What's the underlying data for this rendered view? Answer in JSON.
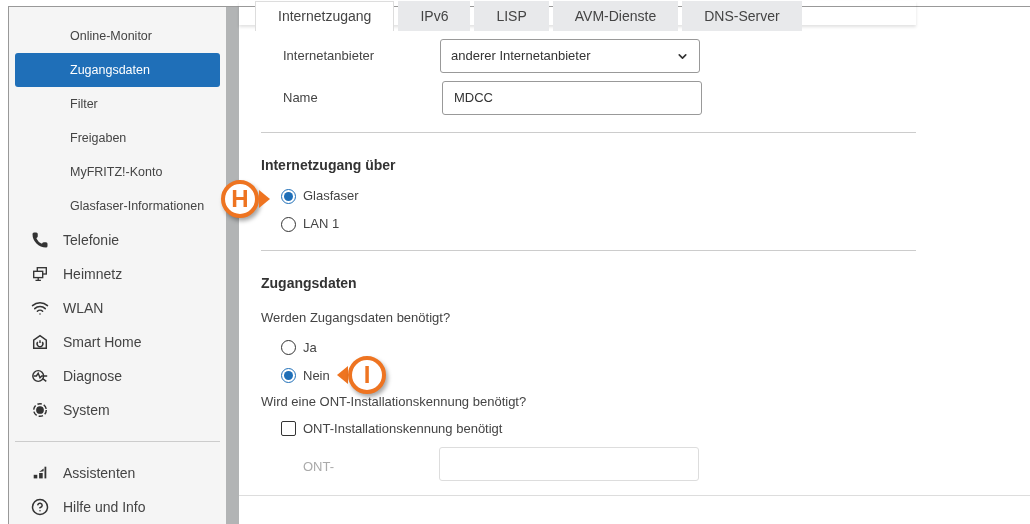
{
  "sidebar": {
    "items": [
      {
        "label": "Online-Monitor",
        "kind": "sub",
        "selected": false
      },
      {
        "label": "Zugangsdaten",
        "kind": "sub",
        "selected": true
      },
      {
        "label": "Filter",
        "kind": "sub",
        "selected": false
      },
      {
        "label": "Freigaben",
        "kind": "sub",
        "selected": false
      },
      {
        "label": "MyFRITZ!-Konto",
        "kind": "sub",
        "selected": false
      },
      {
        "label": "Glasfaser-Informationen",
        "kind": "sub",
        "selected": false
      },
      {
        "label": "Telefonie",
        "kind": "main",
        "selected": false
      },
      {
        "label": "Heimnetz",
        "kind": "main",
        "selected": false
      },
      {
        "label": "WLAN",
        "kind": "main",
        "selected": false
      },
      {
        "label": "Smart Home",
        "kind": "main",
        "selected": false
      },
      {
        "label": "Diagnose",
        "kind": "main",
        "selected": false
      },
      {
        "label": "System",
        "kind": "main",
        "selected": false
      }
    ],
    "footer_items": [
      {
        "label": "Assistenten"
      },
      {
        "label": "Hilfe und Info"
      }
    ]
  },
  "tabs": [
    {
      "label": "Internetzugang",
      "selected": true
    },
    {
      "label": "IPv6",
      "selected": false
    },
    {
      "label": "LISP",
      "selected": false
    },
    {
      "label": "AVM-Dienste",
      "selected": false
    },
    {
      "label": "DNS-Server",
      "selected": false
    }
  ],
  "provider": {
    "label": "Internetanbieter",
    "value": "anderer Internetanbieter"
  },
  "name": {
    "label": "Name",
    "value": "MDCC"
  },
  "access": {
    "heading": "Internetzugang über",
    "options": [
      {
        "label": "Glasfaser",
        "selected": true
      },
      {
        "label": "LAN 1",
        "selected": false
      }
    ]
  },
  "credentials": {
    "heading": "Zugangsdaten",
    "question": "Werden Zugangsdaten benötigt?",
    "options": [
      {
        "label": "Ja",
        "selected": false
      },
      {
        "label": "Nein",
        "selected": true
      }
    ],
    "ont_question": "Wird eine ONT-Installationskennung benötigt?",
    "ont_checkbox": {
      "label": "ONT-Installationskennung benötigt",
      "checked": false
    },
    "ont_field": {
      "label": "ONT-"
    }
  },
  "callouts": [
    {
      "letter": "H"
    },
    {
      "letter": "I"
    }
  ]
}
